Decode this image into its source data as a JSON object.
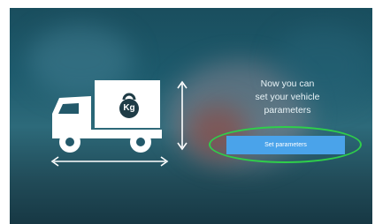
{
  "screen": {
    "message_lines": [
      "Now you can",
      "set your vehicle",
      "parameters"
    ],
    "set_button_label": "Set parameters",
    "weight_label": "Kg",
    "accent_color": "#4aa3ea",
    "highlight_color": "#2fcf4a",
    "icons": [
      "truck-icon",
      "weight-icon",
      "height-arrow-icon",
      "length-arrow-icon"
    ]
  }
}
